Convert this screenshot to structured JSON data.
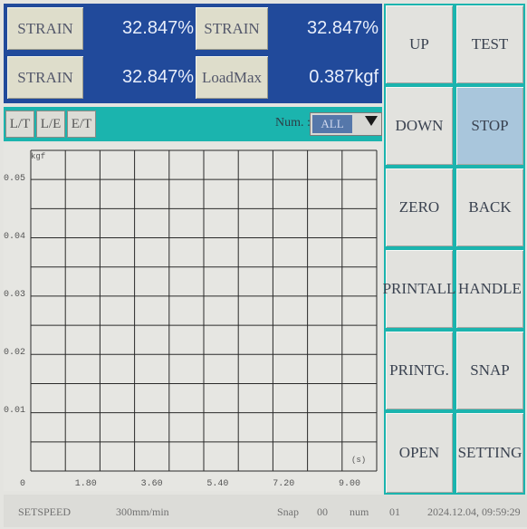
{
  "readouts": [
    {
      "label": "STRAIN",
      "value": "32.847%"
    },
    {
      "label": "STRAIN",
      "value": "32.847%"
    },
    {
      "label": "STRAIN",
      "value": "32.847%"
    },
    {
      "label": "LoadMax",
      "value": "0.387kgf"
    }
  ],
  "mode_tabs": [
    "L/T",
    "L/E",
    "E/T"
  ],
  "num_select": {
    "label": "Num. :",
    "value": "ALL"
  },
  "chart_data": {
    "type": "line",
    "ylabel": "kgf",
    "xlabel": "(s)",
    "y_ticks": [
      "0.05",
      "0.04",
      "0.03",
      "0.02",
      "0.01"
    ],
    "x_ticks": [
      "0",
      "1.80",
      "3.60",
      "5.40",
      "7.20",
      "9.00"
    ],
    "xlim": [
      0,
      9.0
    ],
    "ylim": [
      0,
      0.05
    ],
    "grid": true,
    "series": []
  },
  "keys": [
    {
      "label": "UP"
    },
    {
      "label": "TEST"
    },
    {
      "label": "DOWN"
    },
    {
      "label": "STOP"
    },
    {
      "label": "ZERO"
    },
    {
      "label": "BACK"
    },
    {
      "label": "PRINTALL"
    },
    {
      "label": "HANDLE"
    },
    {
      "label": "PRINTG."
    },
    {
      "label": "SNAP"
    },
    {
      "label": "OPEN"
    },
    {
      "label": "SETTING"
    }
  ],
  "status": {
    "speed_label": "SETSPEED",
    "speed_value": "300mm/min",
    "snap_label": "Snap",
    "snap_value": "00",
    "num_label": "num",
    "num_value": "01",
    "datetime": "2024.12.04, 09:59:29"
  },
  "colors": {
    "panel_blue": "#214a9b",
    "accent_teal": "#1bb4ae",
    "active_key": "#a9c6dc"
  }
}
